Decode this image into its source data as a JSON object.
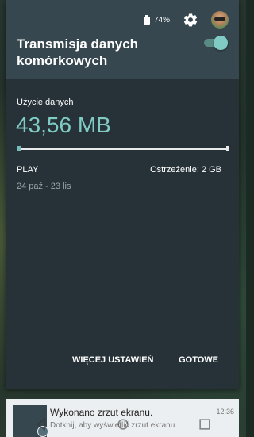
{
  "status": {
    "battery": "74%"
  },
  "header": {
    "title": "Transmisja danych komórkowych",
    "toggle_on": true
  },
  "usage": {
    "label": "Użycie danych",
    "value": "43,56 MB",
    "fill_fraction": 0.02,
    "carrier": "PLAY",
    "warning": "Ostrzeżenie: 2 GB",
    "period": "24 paź - 23 lis"
  },
  "actions": {
    "more": "WIĘCEJ USTAWIEŃ",
    "done": "GOTOWE"
  },
  "notification": {
    "title": "Wykonano zrzut ekranu.",
    "text": "Dotknij, aby wyświetlić zrzut ekranu.",
    "time": "12:36"
  },
  "colors": {
    "accent": "#80cbc4",
    "panel": "#263238",
    "header": "#37474f"
  }
}
